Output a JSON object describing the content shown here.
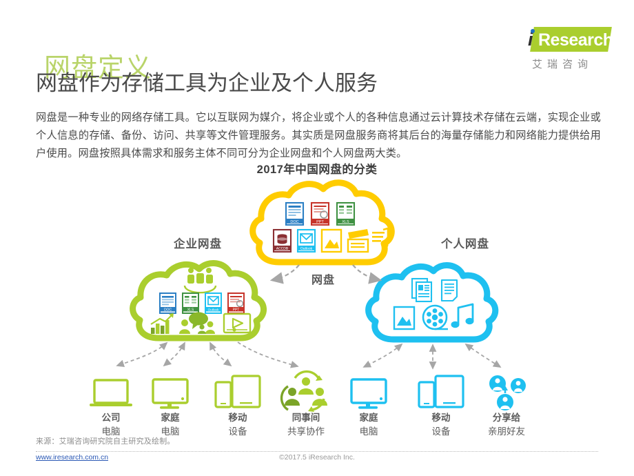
{
  "brand": {
    "logo_i": "i",
    "logo_word": "Research",
    "logo_cn": "艾瑞咨询",
    "green": "#aace2e",
    "blue_dot": "#1f6fc4"
  },
  "header": {
    "watermark_title": "网盘定义",
    "main_title": "网盘作为存储工具为企业及个人服务"
  },
  "body": {
    "paragraph": "网盘是一种专业的网络存储工具。它以互联网为媒介，将企业或个人的各种信息通过云计算技术存储在云端，实现企业或个人信息的存储、备份、访问、共享等文件管理服务。其实质是网盘服务商将其后台的海量存储能力和网络能力提供给用户使用。网盘按照具体需求和服务主体不同可分为企业网盘和个人网盘两大类。"
  },
  "chart_data": {
    "type": "diagram",
    "title": "2017年中国网盘的分类",
    "nodes": [
      {
        "id": "center",
        "label": "网盘",
        "cloud_label": "网盘",
        "color": "#ffcc00",
        "icons": [
          "doc-file-icon",
          "ppt-file-icon",
          "xls-file-icon",
          "database-file-icon",
          "outlook-mail-icon",
          "image-file-icon",
          "video-clapper-icon",
          "music-note-icon"
        ]
      },
      {
        "id": "enterprise",
        "label": "企业网盘",
        "color": "#aace2e",
        "icons": [
          "people-group-icon",
          "doc-file-icon",
          "xls-file-icon",
          "outlook-mail-icon",
          "ppt-file-icon",
          "bar-chart-icon",
          "team-chat-icon",
          "video-player-icon"
        ]
      },
      {
        "id": "personal",
        "label": "个人网盘",
        "color": "#1ec0f0",
        "icons": [
          "documents-icon",
          "text-doc-icon",
          "image-file-icon",
          "film-reel-icon",
          "music-note-icon"
        ]
      }
    ],
    "enterprise_devices": [
      {
        "icon": "laptop-icon",
        "line1": "公司",
        "line2": "电脑"
      },
      {
        "icon": "desktop-monitor-icon",
        "line1": "家庭",
        "line2": "电脑"
      },
      {
        "icon": "mobile-devices-icon",
        "line1": "移动",
        "line2": "设备"
      },
      {
        "icon": "collaboration-icon",
        "line1": "同事间",
        "line2": "共享协作"
      }
    ],
    "personal_devices": [
      {
        "icon": "desktop-monitor-icon",
        "line1": "家庭",
        "line2": "电脑"
      },
      {
        "icon": "mobile-devices-icon",
        "line1": "移动",
        "line2": "设备"
      },
      {
        "icon": "share-people-icon",
        "line1": "分享给",
        "line2": "亲朋好友"
      }
    ],
    "colors": {
      "yellow": "#ffcc00",
      "green": "#aace2e",
      "blue": "#1ec0f0",
      "arrow": "#a6a6a6"
    }
  },
  "footer": {
    "source": "来源：艾瑞咨询研究院自主研究及绘制。",
    "url": "www.iresearch.com.cn",
    "copyright": "©2017.5 iResearch Inc."
  }
}
